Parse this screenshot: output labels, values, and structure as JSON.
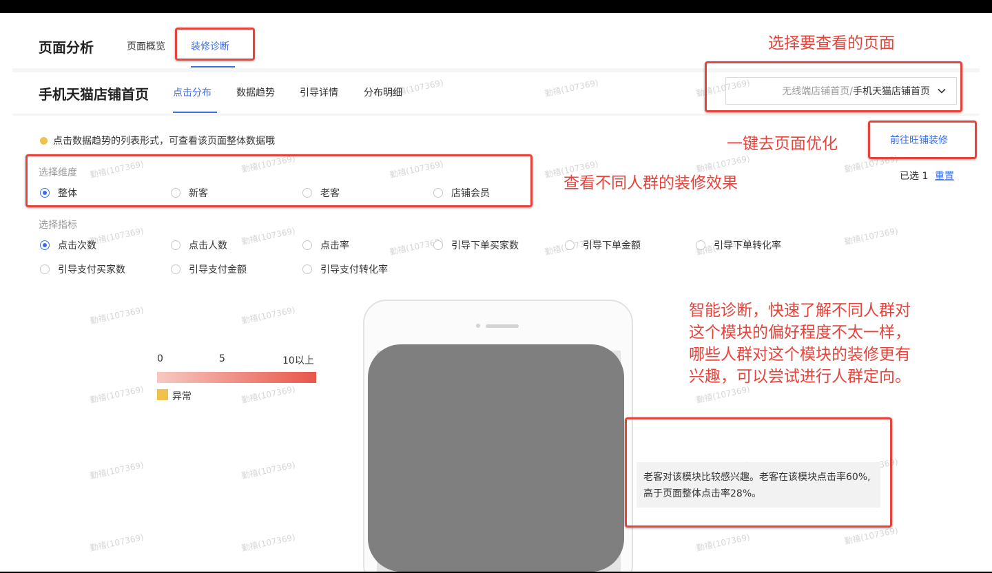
{
  "header": {
    "title": "页面分析",
    "tabs": [
      {
        "label": "页面概览"
      },
      {
        "label": "装修诊断"
      }
    ]
  },
  "subheader": {
    "page_name": "手机天猫店铺首页",
    "tabs": [
      {
        "label": "点击分布"
      },
      {
        "label": "数据趋势"
      },
      {
        "label": "引导详情"
      },
      {
        "label": "分布明细"
      }
    ],
    "page_select": {
      "prefix": "无线端店铺首页/",
      "value": "手机天猫店铺首页"
    }
  },
  "tip": {
    "text": "点击数据趋势的列表形式，可查看该页面整体数据哦"
  },
  "decorate_link": "前往旺铺装修",
  "selection": {
    "count_label": "已选 1",
    "reset_label": "重置"
  },
  "dimension": {
    "label": "选择维度",
    "options": [
      "整体",
      "新客",
      "老客",
      "店铺会员"
    ],
    "selected": "整体"
  },
  "metrics": {
    "label": "选择指标",
    "options": [
      "点击次数",
      "点击人数",
      "点击率",
      "引导下单买家数",
      "引导下单金额",
      "引导下单转化率",
      "引导支付买家数",
      "引导支付金额",
      "引导支付转化率"
    ],
    "selected": "点击次数"
  },
  "legend": {
    "ticks": [
      "0",
      "5",
      "10以上"
    ],
    "abnormal_label": "异常",
    "gradient_from": "#f6c9c0",
    "gradient_to": "#e8564a",
    "abnormal_color": "#f0c24b"
  },
  "insight": {
    "text": "老客对该模块比较感兴趣。老客在该模块点击率60%,高于页面整体点击率28%。"
  },
  "annotations": {
    "select_page": "选择要查看的页面",
    "optimize": "一键去页面优化",
    "crowd": "查看不同人群的装修效果",
    "smart": [
      "智能诊断，快速了解不同人群对",
      "这个模块的偏好程度不太一样，",
      "哪些人群对这个模块的装修更有",
      "兴趣，可以尝试进行人群定向。"
    ]
  },
  "watermark": "勤禧(107369)",
  "colors": {
    "accent": "#3a6ee8",
    "annotation_red": "#e8433a"
  }
}
